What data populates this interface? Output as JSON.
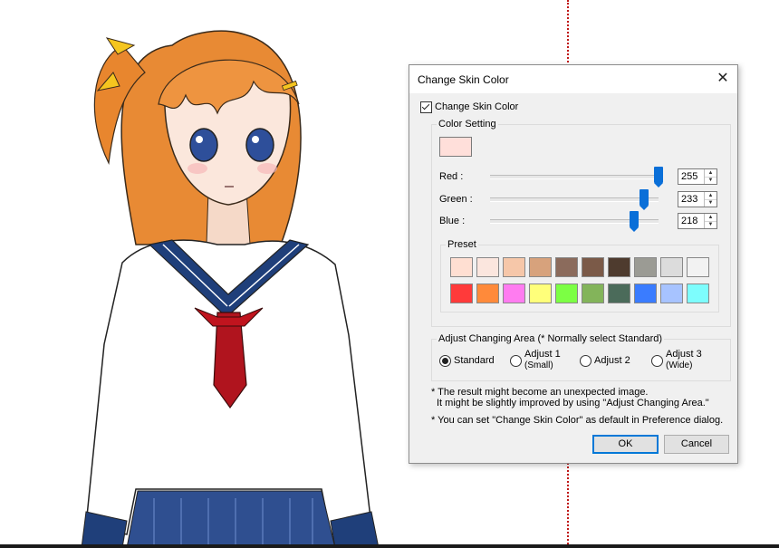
{
  "dialog": {
    "title": "Change Skin Color",
    "close_glyph": "✕",
    "checkbox_label": "Change Skin Color",
    "checkbox_checked": true,
    "color_setting_label": "Color Setting",
    "current_color": "#ffdfda",
    "sliders": [
      {
        "label": "Red :",
        "value": "255",
        "level": 255,
        "max": 255
      },
      {
        "label": "Green :",
        "value": "233",
        "level": 233,
        "max": 255
      },
      {
        "label": "Blue :",
        "value": "218",
        "level": 218,
        "max": 255
      }
    ],
    "preset_label": "Preset",
    "presets": [
      "#ffdfd2",
      "#fbe6de",
      "#f6c7a9",
      "#d7a27c",
      "#8b6b5c",
      "#7b5a48",
      "#4e3b2e",
      "#9b9b94",
      "#dcdcdc",
      "#f2f2f2",
      "#ff3a3a",
      "#ff8a3a",
      "#ff7cf0",
      "#ffff7a",
      "#7cff44",
      "#83b45a",
      "#4b6b5a",
      "#3a7cff",
      "#a7c3ff",
      "#7dfdfd"
    ],
    "area_label": "Adjust Changing Area  (* Normally select Standard)",
    "area_options": [
      {
        "label": "Standard",
        "sub": "",
        "selected": true
      },
      {
        "label": "Adjust 1",
        "sub": "(Small)",
        "selected": false
      },
      {
        "label": "Adjust 2",
        "sub": "",
        "selected": false
      },
      {
        "label": "Adjust 3",
        "sub": "(Wide)",
        "selected": false
      }
    ],
    "notes": [
      "* The result might become an unexpected image.",
      "It might be slightly improved by using \"Adjust Changing Area.\"",
      "* You can set \"Change Skin Color\" as default in Preference dialog."
    ],
    "ok_label": "OK",
    "cancel_label": "Cancel",
    "accent": "#0078d7"
  }
}
